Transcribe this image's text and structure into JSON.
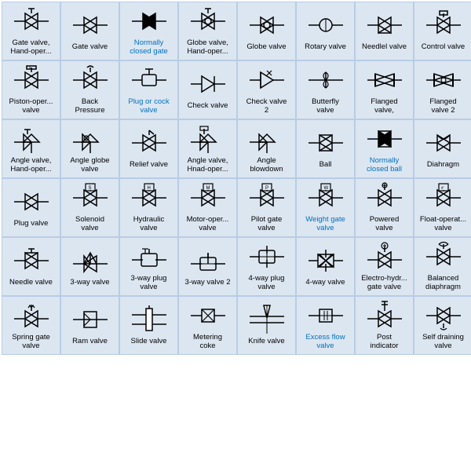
{
  "cells": [
    {
      "id": "gate-valve-hand",
      "label": "Gate valve,\nHand-oper...",
      "blue": false
    },
    {
      "id": "gate-valve",
      "label": "Gate valve",
      "blue": false
    },
    {
      "id": "normally-closed-gate",
      "label": "Normally\nclosed gate",
      "blue": true
    },
    {
      "id": "globe-valve-hand",
      "label": "Globe valve,\nHand-oper...",
      "blue": false
    },
    {
      "id": "globe-valve",
      "label": "Globe valve",
      "blue": false
    },
    {
      "id": "rotary-valve",
      "label": "Rotary valve",
      "blue": false
    },
    {
      "id": "needle-valve-f",
      "label": "Needlel valve",
      "blue": false
    },
    {
      "id": "control-valve",
      "label": "Control valve",
      "blue": false
    },
    {
      "id": "piston-oper-valve",
      "label": "Piston-oper...\nvalve",
      "blue": false
    },
    {
      "id": "back-pressure",
      "label": "Back\nPressure",
      "blue": false
    },
    {
      "id": "plug-or-cock",
      "label": "Plug or cock\nvalve",
      "blue": true
    },
    {
      "id": "check-valve",
      "label": "Check valve",
      "blue": false
    },
    {
      "id": "check-valve-2",
      "label": "Check valve\n2",
      "blue": false
    },
    {
      "id": "butterfly-valve",
      "label": "Butterfly\nvalve",
      "blue": false
    },
    {
      "id": "flanged-valve",
      "label": "Flanged\nvalve,",
      "blue": false
    },
    {
      "id": "flanged-valve-2",
      "label": "Flanged\nvalve 2",
      "blue": false
    },
    {
      "id": "angle-valve-hand",
      "label": "Angle valve,\nHand-oper...",
      "blue": false
    },
    {
      "id": "angle-globe-valve",
      "label": "Angle globe\nvalve",
      "blue": false
    },
    {
      "id": "relief-valve",
      "label": "Relief valve",
      "blue": false
    },
    {
      "id": "angle-valve-hnad",
      "label": "Angle valve,\nHnad-oper...",
      "blue": false
    },
    {
      "id": "angle-blowdown",
      "label": "Angle\nblowdown",
      "blue": false
    },
    {
      "id": "ball",
      "label": "Ball",
      "blue": false
    },
    {
      "id": "normally-closed-ball",
      "label": "Normally\nclosed ball",
      "blue": true
    },
    {
      "id": "diahragm",
      "label": "Diahragm",
      "blue": false
    },
    {
      "id": "plug-valve",
      "label": "Plug valve",
      "blue": false
    },
    {
      "id": "solenoid-valve",
      "label": "Solenoid\nvalve",
      "blue": false
    },
    {
      "id": "hydraulic-valve",
      "label": "Hydraulic\nvalve",
      "blue": false
    },
    {
      "id": "motor-oper-valve",
      "label": "Motor-oper...\nvalve",
      "blue": false
    },
    {
      "id": "pilot-gate-valve",
      "label": "Pilot gate\nvalve",
      "blue": false
    },
    {
      "id": "weight-gate-valve",
      "label": "Weight gate\nvalve",
      "blue": true
    },
    {
      "id": "powered-valve",
      "label": "Powered\nvalve",
      "blue": false
    },
    {
      "id": "float-operat-valve",
      "label": "Float-operat...\nvalve",
      "blue": false
    },
    {
      "id": "needle-valve",
      "label": "Needle valve",
      "blue": false
    },
    {
      "id": "3way-valve",
      "label": "3-way valve",
      "blue": false
    },
    {
      "id": "3way-plug-valve",
      "label": "3-way plug\nvalve",
      "blue": false
    },
    {
      "id": "3way-valve-2",
      "label": "3-way valve 2",
      "blue": false
    },
    {
      "id": "4way-plug-valve",
      "label": "4-way plug\nvalve",
      "blue": false
    },
    {
      "id": "4way-valve",
      "label": "4-way valve",
      "blue": false
    },
    {
      "id": "electro-hydr-gate",
      "label": "Electro-hydr...\ngate valve",
      "blue": false
    },
    {
      "id": "balanced-diaphragm",
      "label": "Balanced\ndiaphragm",
      "blue": false
    },
    {
      "id": "spring-gate-valve",
      "label": "Spring gate\nvalve",
      "blue": false
    },
    {
      "id": "ram-valve",
      "label": "Ram valve",
      "blue": false
    },
    {
      "id": "slide-valve",
      "label": "Slide valve",
      "blue": false
    },
    {
      "id": "metering-coke",
      "label": "Metering\ncoke",
      "blue": false
    },
    {
      "id": "knife-valve",
      "label": "Knife valve",
      "blue": false
    },
    {
      "id": "excess-flow-valve",
      "label": "Excess flow\nvalve",
      "blue": true
    },
    {
      "id": "post-indicator",
      "label": "Post\nindicator",
      "blue": false
    },
    {
      "id": "self-draining-valve",
      "label": "Self draining\nvalve",
      "blue": false
    }
  ]
}
